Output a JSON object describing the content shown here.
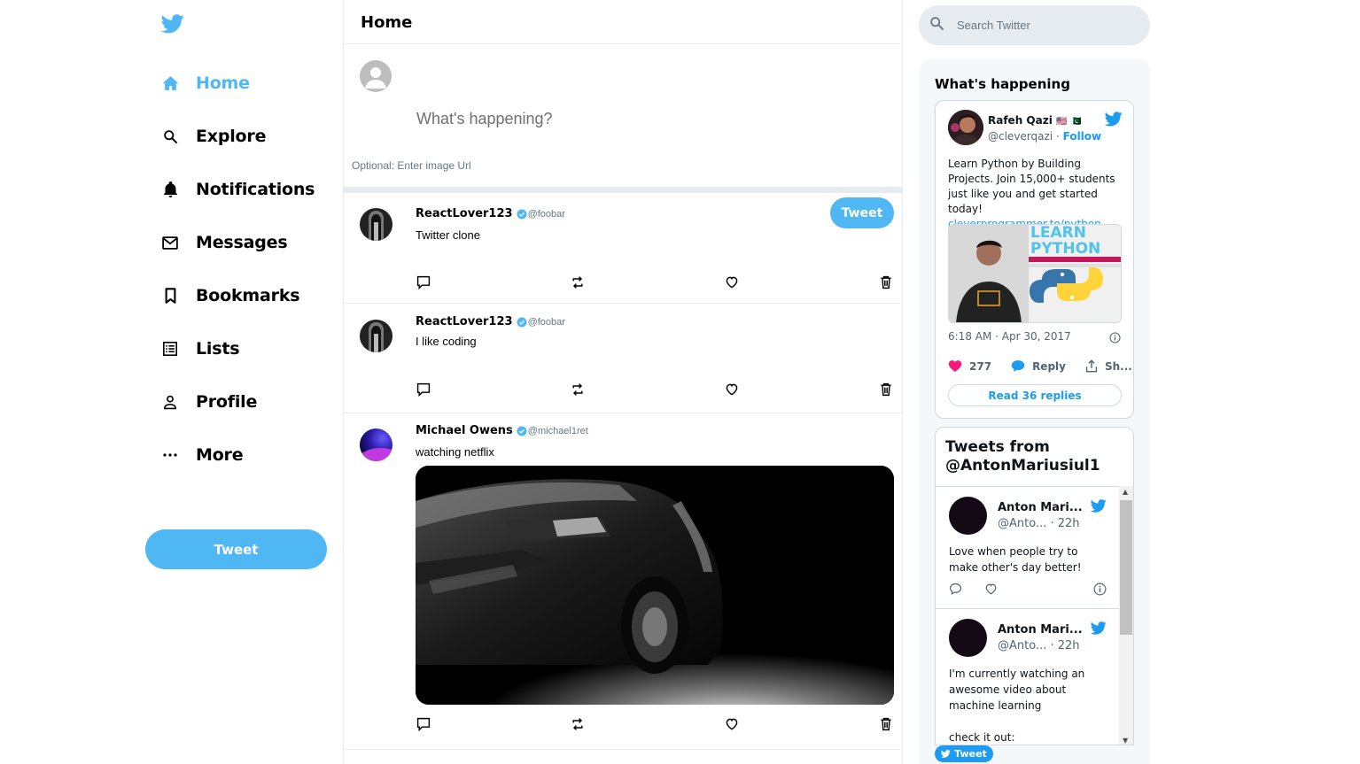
{
  "colors": {
    "accent": "#50b7f5",
    "twitter_blue": "#1d9bf0",
    "like_pink": "#f91880"
  },
  "sidebar": {
    "logo_icon": "twitter-bird-icon",
    "items": [
      {
        "label": "Home",
        "icon": "home-icon",
        "active": true
      },
      {
        "label": "Explore",
        "icon": "search-icon"
      },
      {
        "label": "Notifications",
        "icon": "bell-icon"
      },
      {
        "label": "Messages",
        "icon": "mail-icon"
      },
      {
        "label": "Bookmarks",
        "icon": "bookmark-icon"
      },
      {
        "label": "Lists",
        "icon": "list-icon"
      },
      {
        "label": "Profile",
        "icon": "person-icon"
      },
      {
        "label": "More",
        "icon": "more-icon"
      }
    ],
    "tweet_button": "Tweet"
  },
  "feed": {
    "title": "Home",
    "tweetbox": {
      "placeholder": "What's happening?",
      "image_placeholder": "Optional: Enter image Url",
      "button": "Tweet"
    },
    "posts": [
      {
        "name": "ReactLover123",
        "handle": "@foobar",
        "text": "Twitter clone",
        "verified": true
      },
      {
        "name": "ReactLover123",
        "handle": "@foobar",
        "text": "I like coding",
        "verified": true
      },
      {
        "name": "Michael Owens",
        "handle": "@michael1ret",
        "text": "watching netflix",
        "verified": true,
        "has_image": true
      }
    ]
  },
  "widgets": {
    "search_placeholder": "Search Twitter",
    "title": "What's happening",
    "embed": {
      "name": "Rafeh Qazi",
      "flags": "🇺🇸 🇵🇰",
      "handle": "@cleverqazi",
      "separator": "·",
      "follow": "Follow",
      "text": "Learn Python by Building Projects. Join 15,000+ students just like you and get started today!",
      "link": "cleverprogrammer.to/python",
      "image_caption_1": "LEARN",
      "image_caption_2": "PYTHON",
      "time": "6:18 AM · Apr 30, 2017",
      "likes": "277",
      "reply": "Reply",
      "share": "Sh...",
      "read_replies": "Read 36 replies"
    },
    "timeline": {
      "title": "Tweets from @AntonMariusiul1",
      "items": [
        {
          "name": "Anton Mari...",
          "handle": "@Anto...",
          "time": "· 22h",
          "text": "Love when people try to make other's day better!"
        },
        {
          "name": "Anton Mari...",
          "handle": "@Anto...",
          "time": "· 22h",
          "text": "I'm currently watching an awesome video about machine learning",
          "text2": "check it out:"
        }
      ],
      "tweet_button": "Tweet"
    }
  }
}
